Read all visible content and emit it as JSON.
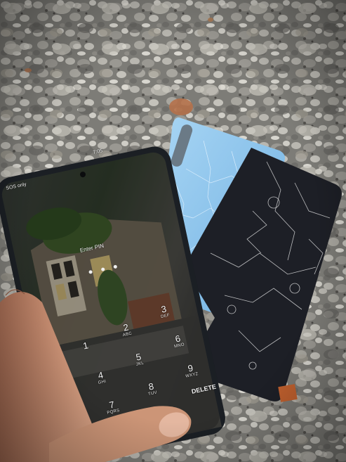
{
  "status": {
    "carrier": "SOS only",
    "time": "7:05"
  },
  "lock_screen": {
    "title": "Enter PIN",
    "delete_label": "DELETE",
    "keys": [
      {
        "digit": "1",
        "letters": ""
      },
      {
        "digit": "2",
        "letters": "ABC"
      },
      {
        "digit": "3",
        "letters": "DEF"
      },
      {
        "digit": "4",
        "letters": "GHI"
      },
      {
        "digit": "5",
        "letters": "JKL"
      },
      {
        "digit": "6",
        "letters": "MNO"
      },
      {
        "digit": "7",
        "letters": "PQRS"
      },
      {
        "digit": "8",
        "letters": "TUV"
      },
      {
        "digit": "9",
        "letters": "WXYZ"
      }
    ]
  },
  "colors": {
    "gravel": "#8d8c86",
    "phone_body": "#1b1f24",
    "back_cover": "#8cc4ec",
    "cracked_glass": "#1d1f26",
    "skin": "#c98f72"
  }
}
